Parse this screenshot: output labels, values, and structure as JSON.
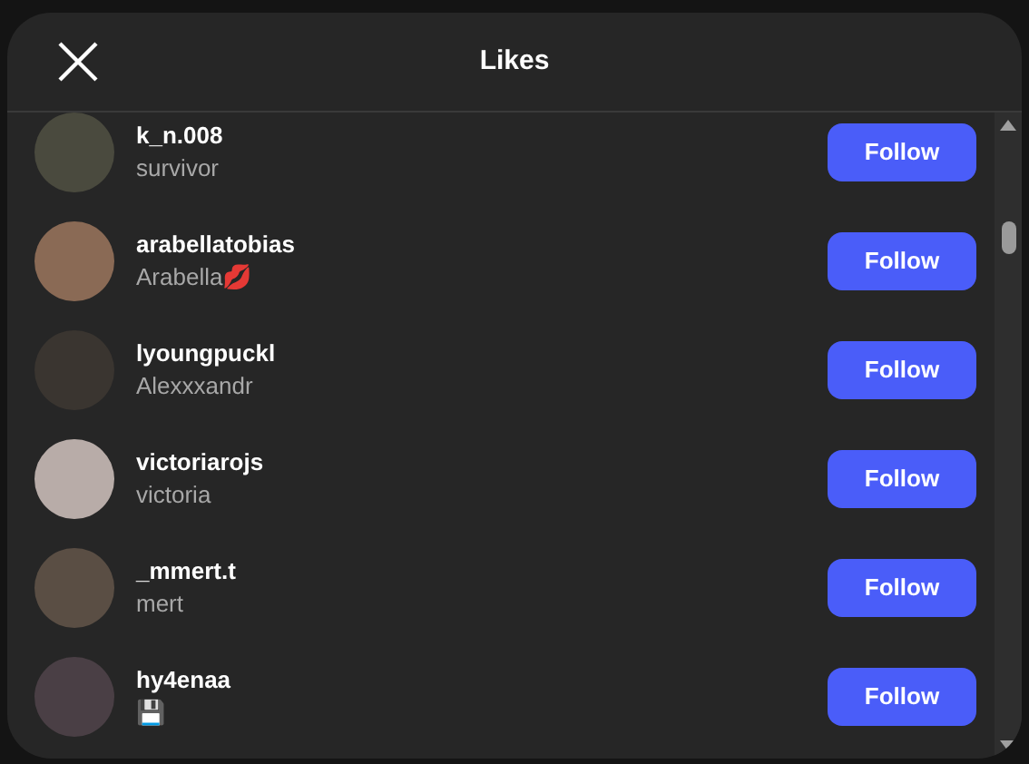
{
  "dialog": {
    "title": "Likes"
  },
  "users": [
    {
      "username": "k_n.008",
      "name": "survivor",
      "button": "Follow"
    },
    {
      "username": "arabellatobias",
      "name": "Arabella💋",
      "button": "Follow"
    },
    {
      "username": "lyoungpuckl",
      "name": "Alexxxandr",
      "button": "Follow"
    },
    {
      "username": "victoriarojs",
      "name": "victoria",
      "button": "Follow"
    },
    {
      "username": "_mmert.t",
      "name": "mert",
      "button": "Follow"
    },
    {
      "username": "hy4enaa",
      "name": "💾",
      "button": "Follow"
    }
  ]
}
